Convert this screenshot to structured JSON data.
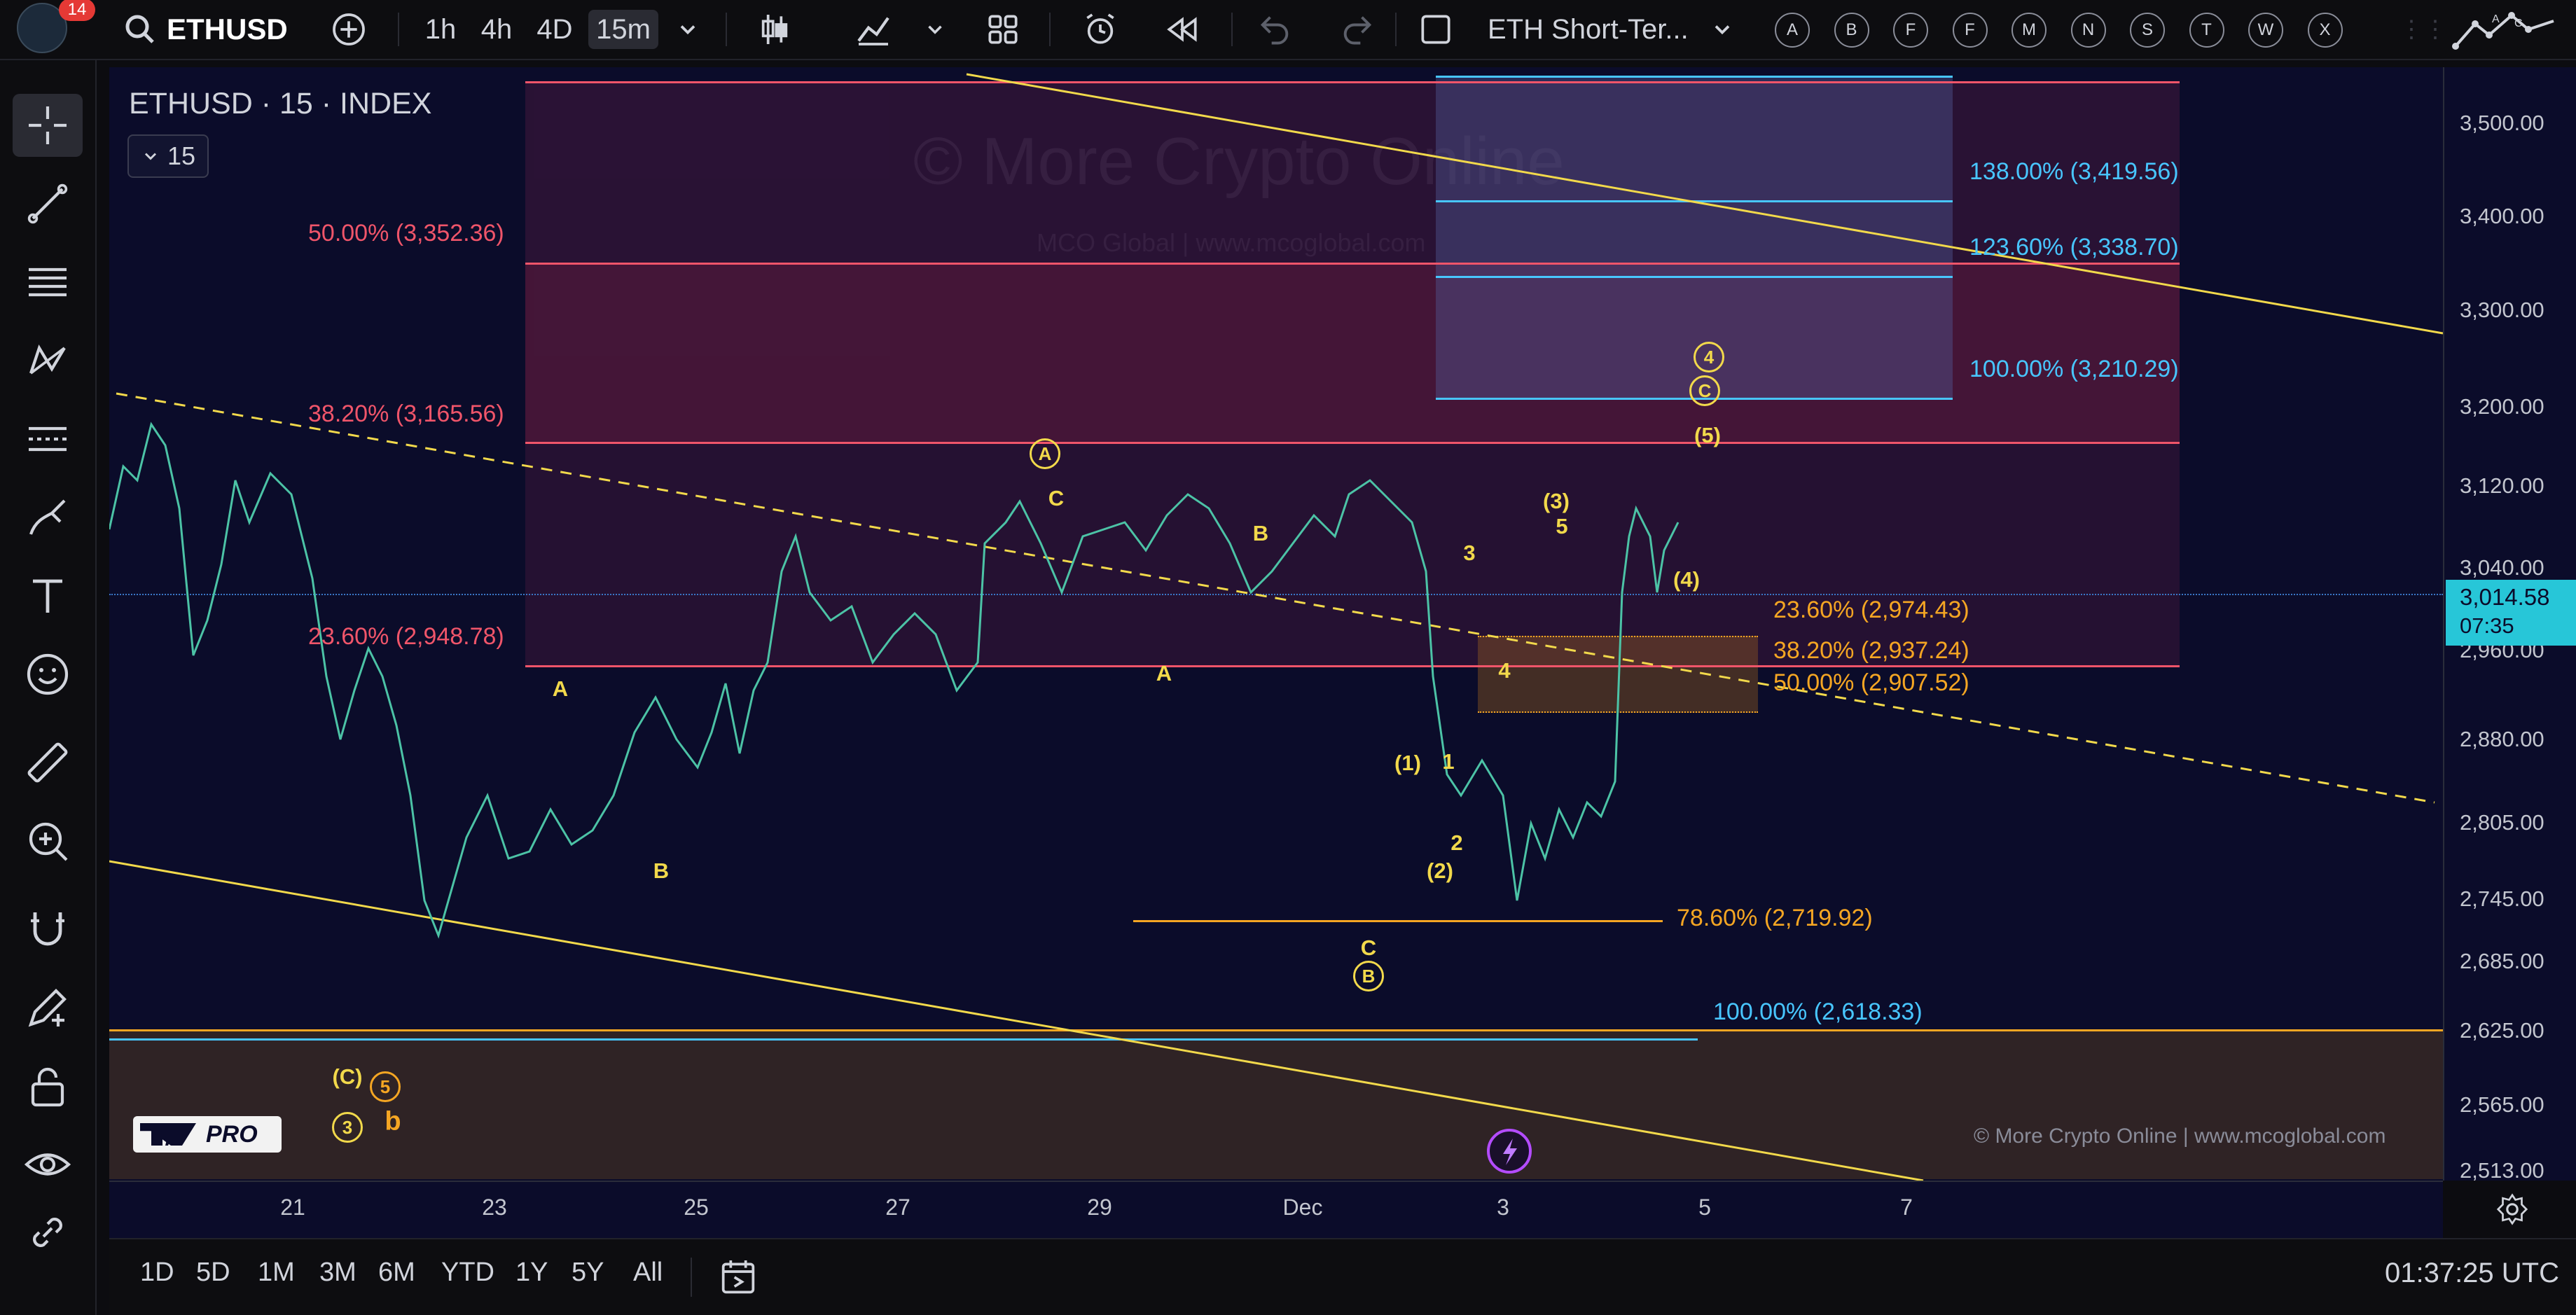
{
  "toolbar": {
    "notification_count": "14",
    "symbol": "ETHUSD",
    "intervals": [
      "1h",
      "4h",
      "4D",
      "15m"
    ],
    "active_interval": "15m",
    "layout_name": "ETH Short-Ter...",
    "alert_letters": [
      "A",
      "B",
      "F",
      "F",
      "M",
      "N",
      "S",
      "T",
      "W",
      "X"
    ]
  },
  "chart": {
    "title": "ETHUSD · 15 · INDEX",
    "interval_badge": "15",
    "watermark_main": "© More Crypto Online",
    "watermark_sub": "MCO Global  |  www.mcoglobal.com",
    "footer_credit": "© More Crypto Online  |  www.mcoglobal.com",
    "logo_text": "PRO",
    "colors": {
      "bg": "#0b0c2a",
      "red": "#f0556a",
      "blue": "#48c6ff",
      "orange": "#f5a623",
      "yellow": "#f2d94b"
    }
  },
  "fib_labels": {
    "red_50": "50.00% (3,352.36)",
    "red_382": "38.20% (3,165.56)",
    "red_236": "23.60% (2,948.78)",
    "blue_138": "138.00% (3,419.56)",
    "blue_1236": "123.60% (3,338.70)",
    "blue_100": "100.00% (3,210.29)",
    "orange_236": "23.60% (2,974.43)",
    "orange_382": "38.20% (2,937.24)",
    "orange_50": "50.00% (2,907.52)",
    "orange_786": "78.60% (2,719.92)",
    "blue_100_low": "100.00% (2,618.33)"
  },
  "waves": {
    "A1": "A",
    "B1": "B",
    "Ac": "A",
    "Cw": "C",
    "Aw": "A",
    "Bw": "B",
    "Cl": "C",
    "Bc": "B",
    "p1": "(1)",
    "w1": "1",
    "w2": "2",
    "p2": "(2)",
    "w3": "3",
    "w4": "4",
    "p3": "(3)",
    "w5": "5",
    "p4": "(4)",
    "p5": "(5)",
    "c4": "4",
    "cC": "C",
    "pC": "(C)",
    "c5": "5",
    "c3": "3",
    "lb": "b"
  },
  "price_axis": {
    "ticks": [
      "3,500.00",
      "3,400.00",
      "3,300.00",
      "3,200.00",
      "3,120.00",
      "3,040.00",
      "2,960.00",
      "2,880.00",
      "2,805.00",
      "2,745.00",
      "2,685.00",
      "2,625.00",
      "2,565.00",
      "2,513.00"
    ],
    "current_price": "3,014.58",
    "countdown": "07:35"
  },
  "time_axis": {
    "ticks": [
      "21",
      "23",
      "25",
      "27",
      "29",
      "Dec",
      "3",
      "5",
      "7"
    ]
  },
  "bottom": {
    "ranges": [
      "1D",
      "5D",
      "1M",
      "3M",
      "6M",
      "YTD",
      "1Y",
      "5Y",
      "All"
    ],
    "clock": "01:37:25 UTC"
  }
}
